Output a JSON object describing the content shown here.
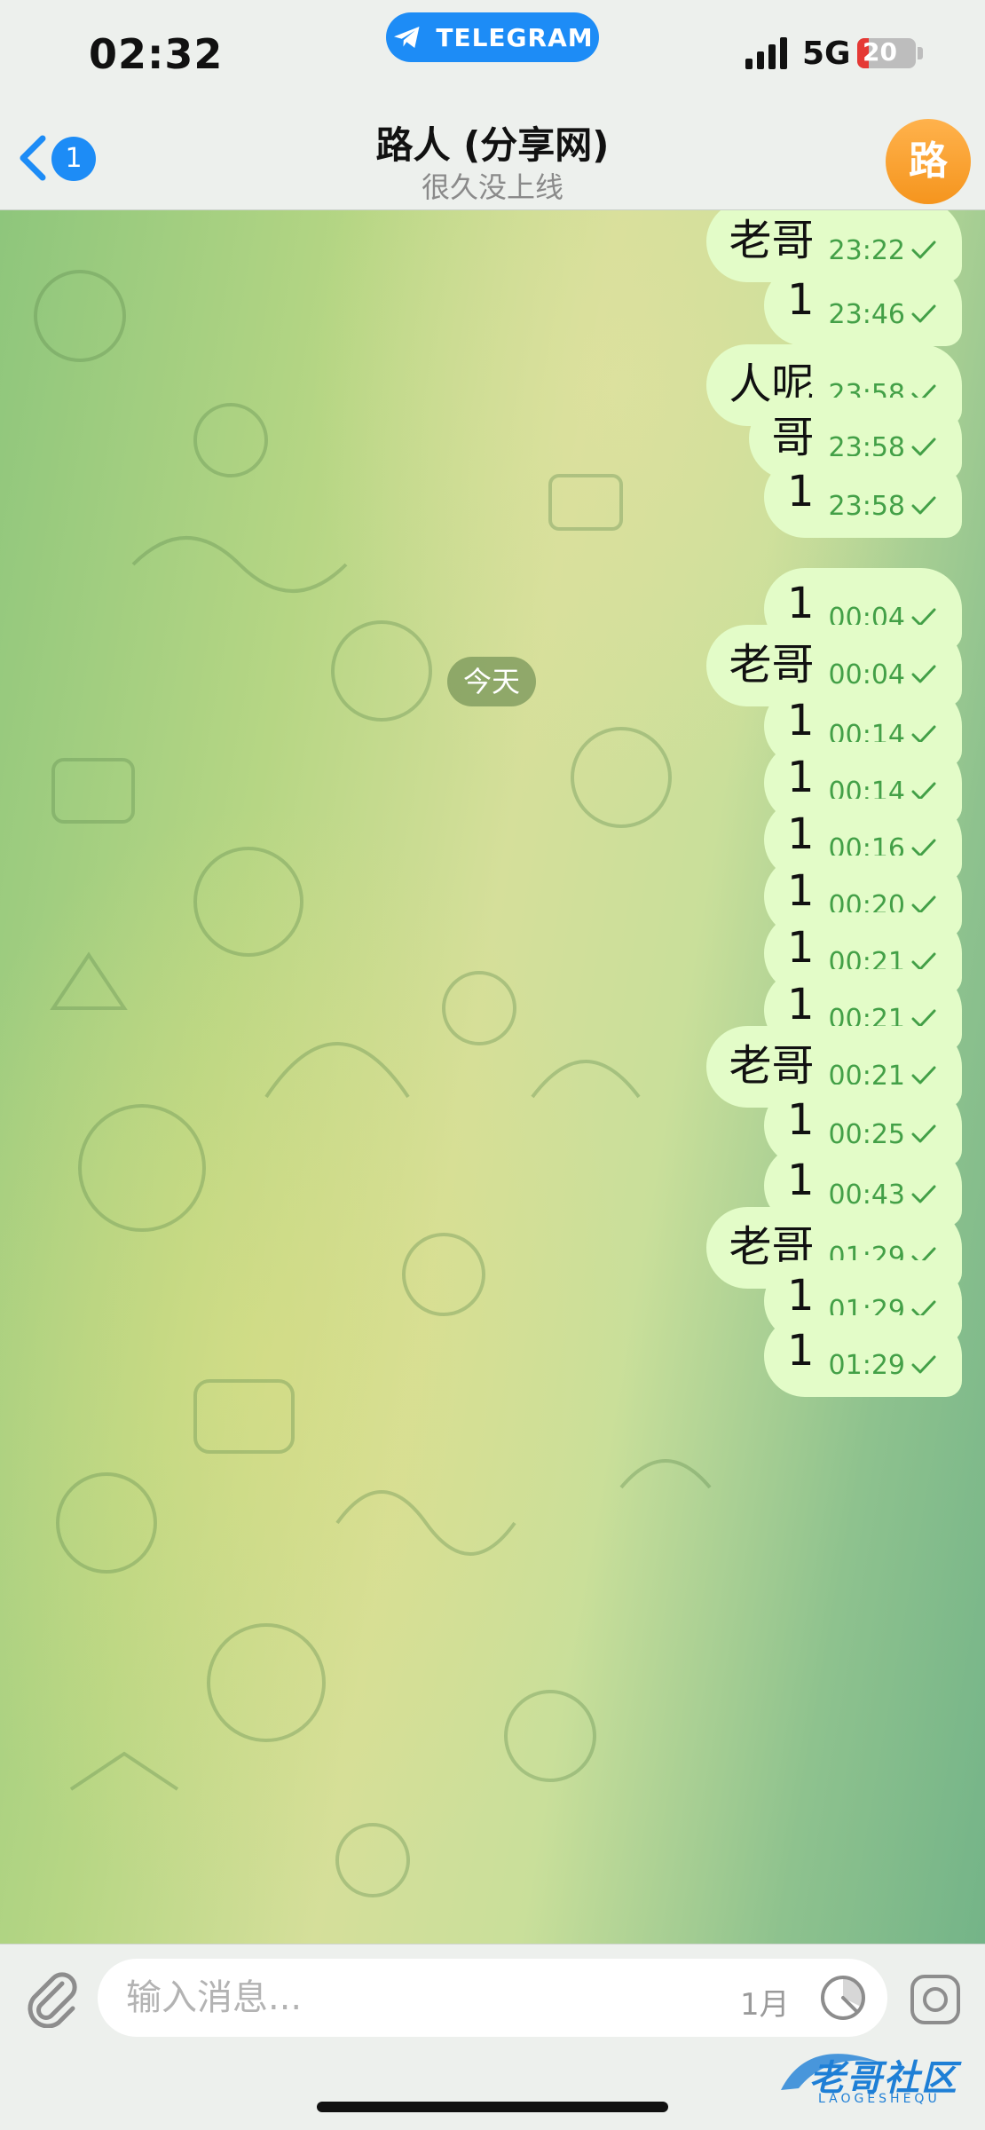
{
  "status_bar": {
    "time": "02:32",
    "app_pill": "TELEGRAM",
    "network": "5G",
    "battery": "20",
    "battery_level": 0.2
  },
  "header": {
    "back_badge": "1",
    "title": "路人 (分享网)",
    "subtitle": "很久没上线",
    "avatar_letter": "路"
  },
  "chat": {
    "date_separator": "今天",
    "messages": [
      {
        "text": "老哥",
        "time": "23:22"
      },
      {
        "text": "1",
        "time": "23:46"
      },
      {
        "text": "人呢",
        "time": "23:58"
      },
      {
        "text": "哥",
        "time": "23:58"
      },
      {
        "text": "1",
        "time": "23:58"
      },
      {
        "text": "1",
        "time": "00:04"
      },
      {
        "text": "老哥",
        "time": "00:04"
      },
      {
        "text": "1",
        "time": "00:14"
      },
      {
        "text": "1",
        "time": "00:14"
      },
      {
        "text": "1",
        "time": "00:16"
      },
      {
        "text": "1",
        "time": "00:20"
      },
      {
        "text": "1",
        "time": "00:21"
      },
      {
        "text": "1",
        "time": "00:21"
      },
      {
        "text": "老哥",
        "time": "00:21"
      },
      {
        "text": "1",
        "time": "00:25"
      },
      {
        "text": "1",
        "time": "00:43"
      },
      {
        "text": "老哥",
        "time": "01:29"
      },
      {
        "text": "1",
        "time": "01:29"
      },
      {
        "text": "1",
        "time": "01:29"
      }
    ]
  },
  "input_bar": {
    "placeholder": "输入消息...",
    "schedule_label": "1月"
  },
  "watermark": {
    "text": "老哥社区",
    "sub": "LAOGESHEQU"
  },
  "colors": {
    "accent": "#1d8cf6",
    "bubble": "#e3fcc8",
    "timestamp": "#43a047",
    "avatar": "#f5951e"
  }
}
